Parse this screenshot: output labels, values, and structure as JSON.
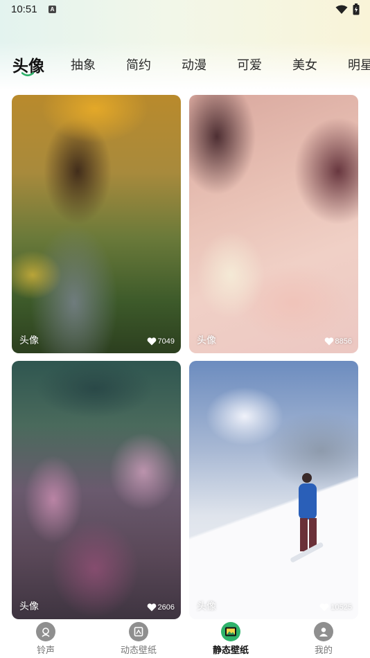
{
  "status_bar": {
    "time": "10:51",
    "notification_icon": "a-letter-icon",
    "wifi_icon": "wifi-icon",
    "battery_icon": "battery-icon"
  },
  "tabs": [
    {
      "label": "头像",
      "active": true
    },
    {
      "label": "抽象",
      "active": false
    },
    {
      "label": "简约",
      "active": false
    },
    {
      "label": "动漫",
      "active": false
    },
    {
      "label": "可爱",
      "active": false
    },
    {
      "label": "美女",
      "active": false
    },
    {
      "label": "明星",
      "active": false
    }
  ],
  "cards": [
    {
      "label": "头像",
      "likes": "7049",
      "image": "woman-in-grass-with-flowers"
    },
    {
      "label": "头像",
      "likes": "8856",
      "image": "anime-girl-lying-down"
    },
    {
      "label": "头像",
      "likes": "2606",
      "image": "pink-wildflowers"
    },
    {
      "label": "头像",
      "likes": "10525",
      "image": "snowboarder-on-snowy-mountain"
    }
  ],
  "bottom_nav": [
    {
      "label": "铃声",
      "icon": "ringtone-icon",
      "active": false
    },
    {
      "label": "动态壁纸",
      "icon": "live-wallpaper-icon",
      "active": false
    },
    {
      "label": "静态壁纸",
      "icon": "static-wallpaper-icon",
      "active": true
    },
    {
      "label": "我的",
      "icon": "profile-icon",
      "active": false
    }
  ],
  "colors": {
    "accent": "#2fb36b",
    "inactive_icon": "#8f8f8f"
  }
}
